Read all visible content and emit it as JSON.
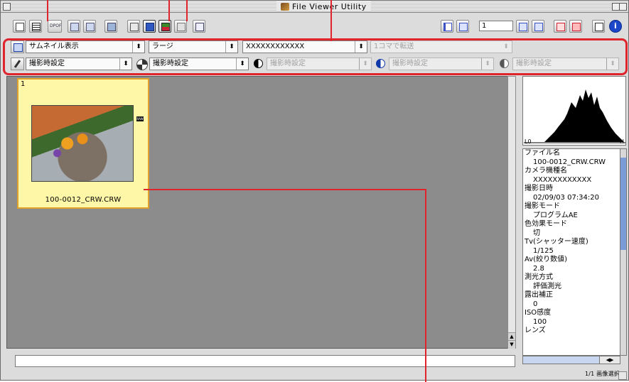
{
  "window": {
    "title": "File Viewer Utility"
  },
  "toolbar": {
    "page_number": "1",
    "buttons": [
      "copy-icon",
      "list-icon",
      "dpof-icon",
      "rotate-left-icon",
      "rotate-right-icon",
      "image-icon",
      "save-icon",
      "print-icon",
      "convert-icon",
      "transfer-icon",
      "wave-icon",
      "first-icon",
      "prev-icon",
      "next-icon",
      "last-icon",
      "view1-icon",
      "view2-icon",
      "view3-icon",
      "info-icon"
    ],
    "dpof_label": "DPOF"
  },
  "options_row": {
    "view_mode": "サムネイル表示",
    "thumb_size": "ラージ",
    "camera": "XXXXXXXXXXXX",
    "transfer": "1コマで転送"
  },
  "settings_row": {
    "wb": "撮影時設定",
    "sharpness": "撮影時設定",
    "contrast": "撮影時設定",
    "saturation": "撮影時設定",
    "tone": "撮影時設定"
  },
  "thumbnail": {
    "index": "1",
    "filename": "100-0012_CRW.CRW",
    "badge": "RAW"
  },
  "histogram": {
    "left_label": "L0",
    "right_label": "H"
  },
  "info": [
    {
      "label": "ファイル名",
      "value": "100-0012_CRW.CRW"
    },
    {
      "label": "カメラ機種名",
      "value": "XXXXXXXXXXXX"
    },
    {
      "label": "撮影日時",
      "value": "02/09/03 07:34:20"
    },
    {
      "label": "撮影モード",
      "value": "プログラムAE"
    },
    {
      "label": "色効果モード",
      "value": "切"
    },
    {
      "label": "Tv(シャッター速度)",
      "value": "1/125"
    },
    {
      "label": "Av(絞り数値)",
      "value": "2.8"
    },
    {
      "label": "測光方式",
      "value": "評価測光"
    },
    {
      "label": "露出補正",
      "value": "0"
    },
    {
      "label": "ISO感度",
      "value": "100"
    },
    {
      "label": "レンズ",
      "value": ""
    }
  ],
  "status": {
    "selection": "1/1 画像選択"
  }
}
